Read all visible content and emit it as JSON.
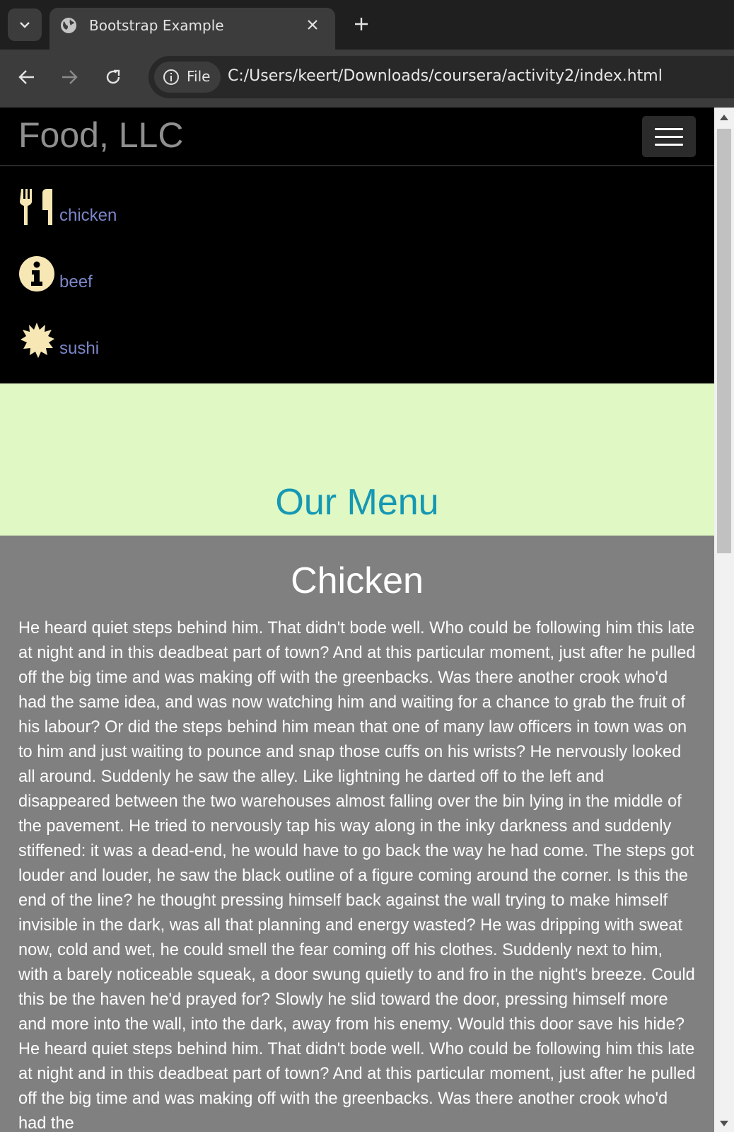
{
  "browser": {
    "tab_title": "Bootstrap Example",
    "site_chip_label": "File",
    "url": "C:/Users/keert/Downloads/coursera/activity2/index.html"
  },
  "navbar": {
    "brand": "Food, LLC"
  },
  "menu_links": [
    {
      "icon": "cutlery-icon",
      "label": "chicken"
    },
    {
      "icon": "info-icon",
      "label": "beef"
    },
    {
      "icon": "certificate-icon",
      "label": "sushi"
    }
  ],
  "hero": {
    "title": "Our Menu"
  },
  "section": {
    "heading": "Chicken",
    "body": "He heard quiet steps behind him. That didn't bode well. Who could be following him this late at night and in this deadbeat part of town? And at this particular moment, just after he pulled off the big time and was making off with the greenbacks. Was there another crook who'd had the same idea, and was now watching him and waiting for a chance to grab the fruit of his labour? Or did the steps behind him mean that one of many law officers in town was on to him and just waiting to pounce and snap those cuffs on his wrists? He nervously looked all around. Suddenly he saw the alley. Like lightning he darted off to the left and disappeared between the two warehouses almost falling over the bin lying in the middle of the pavement. He tried to nervously tap his way along in the inky darkness and suddenly stiffened: it was a dead-end, he would have to go back the way he had come. The steps got louder and louder, he saw the black outline of a figure coming around the corner. Is this the end of the line? he thought pressing himself back against the wall trying to make himself invisible in the dark, was all that planning and energy wasted? He was dripping with sweat now, cold and wet, he could smell the fear coming off his clothes. Suddenly next to him, with a barely noticeable squeak, a door swung quietly to and fro in the night's breeze. Could this be the haven he'd prayed for? Slowly he slid toward the door, pressing himself more and more into the wall, into the dark, away from his enemy. Would this door save his hide?He heard quiet steps behind him. That didn't bode well. Who could be following him this late at night and in this deadbeat part of town? And at this particular moment, just after he pulled off the big time and was making off with the greenbacks. Was there another crook who'd had the"
  },
  "colors": {
    "hero_bg": "#dff8c4",
    "hero_title": "#1598b4",
    "content_bg": "#808080",
    "link": "#7b86c8",
    "icon": "#f6e7b5"
  }
}
